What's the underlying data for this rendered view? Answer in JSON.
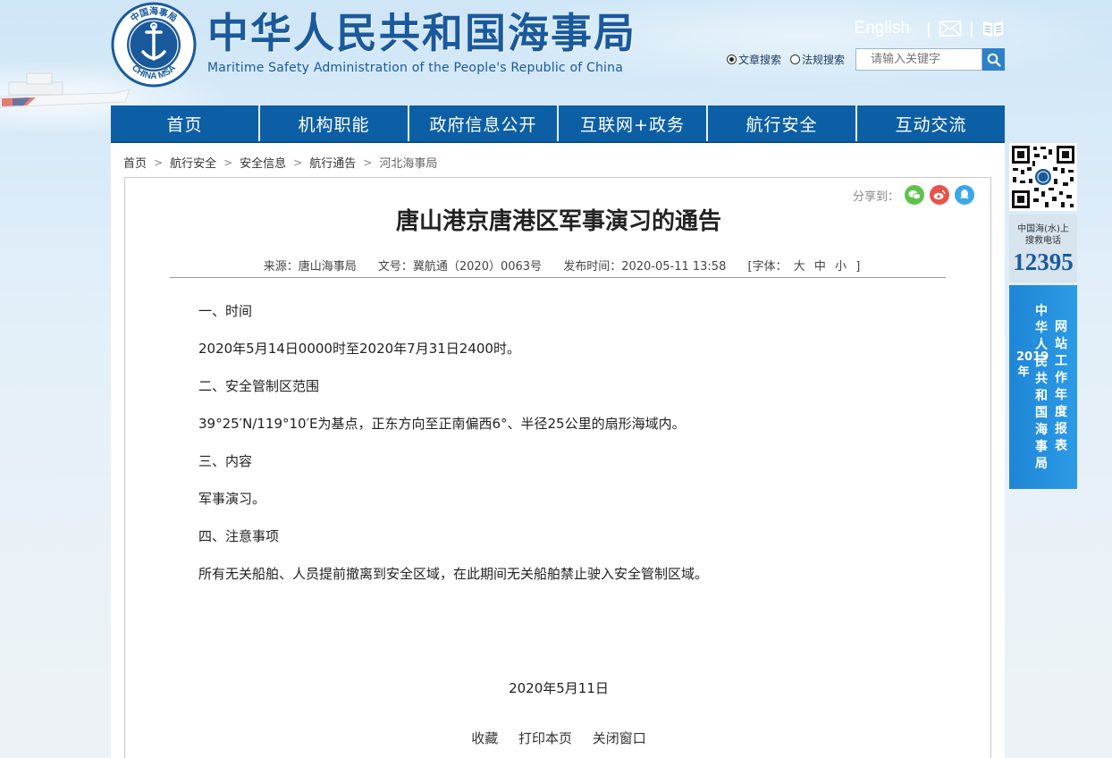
{
  "header": {
    "logo_text_cn": "中华人民共和国海事局",
    "logo_text_en": "Maritime Safety Administration of the People's Republic of China",
    "emblem_text_top": "中国海事局",
    "emblem_text_bottom": "CHINA MSA",
    "english_link": "English",
    "search_options": [
      "文章搜索",
      "法规搜索"
    ],
    "search_selected": "文章搜索",
    "search_placeholder": "请输入关键字"
  },
  "nav": {
    "items": [
      "首页",
      "机构职能",
      "政府信息公开",
      "互联网+政务",
      "航行安全",
      "互动交流"
    ]
  },
  "breadcrumb": [
    "首页",
    "航行安全",
    "安全信息",
    "航行通告",
    "河北海事局"
  ],
  "article": {
    "share_label": "分享到：",
    "title": "唐山港京唐港区军事演习的通告",
    "source": "来源：唐山海事局",
    "doc_no": "文号：冀航通（2020）0063号",
    "publish_time": "发布时间：2020-05-11 13:58",
    "font_label": "[字体：",
    "font_sizes": [
      "大",
      "中",
      "小"
    ],
    "font_close": "]",
    "paragraphs": [
      "一、时间",
      "2020年5月14日0000时至2020年7月31日2400时。",
      "二、安全管制区范围",
      "39°25′N/119°10′E为基点，正东方向至正南偏西6°、半径25公里的扇形海域内。",
      "三、内容",
      "军事演习。",
      "四、注意事项",
      "所有无关船舶、人员提前撤离到安全区域，在此期间无关船舶禁止驶入安全管制区域。"
    ],
    "date": "2020年5月11日",
    "actions": [
      "收藏",
      "打印本页",
      "关闭窗口"
    ]
  },
  "sidebar": {
    "hotline_label_1": "中国海(水)上",
    "hotline_label_2": "搜救电话",
    "hotline_number": "12395",
    "report_col1": "中华人民共和国海事局",
    "report_col2": "网站工作年度报表",
    "report_year": "2019年"
  },
  "colors": {
    "nav_bg": "#0d5fa5",
    "brand_text": "#1a5a9c",
    "report_bg": "#2c9be6"
  }
}
